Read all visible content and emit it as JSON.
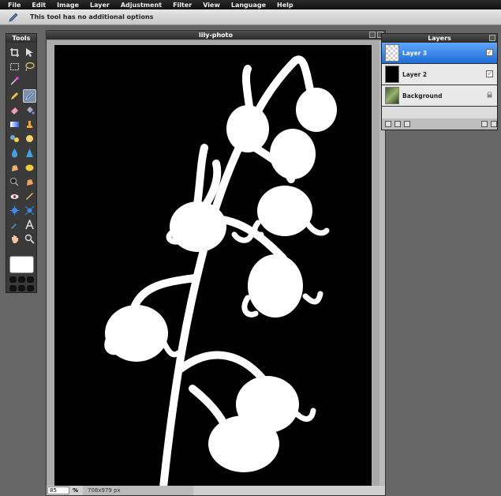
{
  "menu": [
    "File",
    "Edit",
    "Image",
    "Layer",
    "Adjustment",
    "Filter",
    "View",
    "Language",
    "Help"
  ],
  "options": {
    "message": "This tool has no additional options"
  },
  "tools_panel": {
    "title": "Tools"
  },
  "canvas": {
    "title": "lily-photo",
    "zoom": "85",
    "zoom_unit": "%",
    "dimensions": "708x979 px"
  },
  "layers_panel": {
    "title": "Layers",
    "layers": [
      {
        "name": "Layer 3",
        "visible": true,
        "selected": true
      },
      {
        "name": "Layer 2",
        "visible": true,
        "selected": false
      },
      {
        "name": "Background",
        "locked": true,
        "selected": false
      }
    ]
  },
  "colors": {
    "accent": "#1e6cd8",
    "foreground": "#ffffff",
    "background": "#000000"
  }
}
